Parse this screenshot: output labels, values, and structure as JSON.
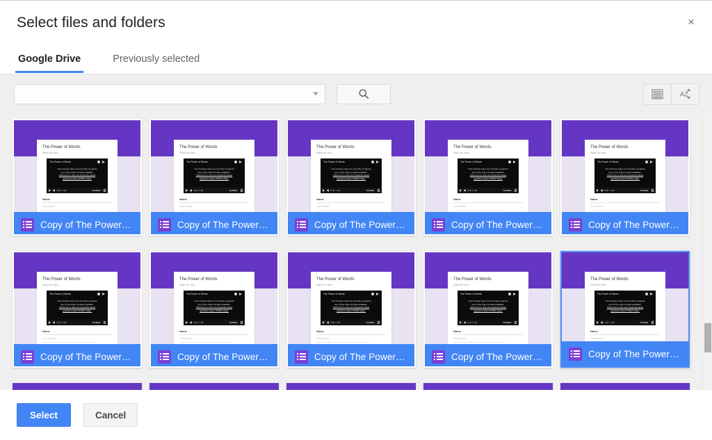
{
  "dialog": {
    "title": "Select files and folders",
    "close_label": "×"
  },
  "tabs": [
    {
      "label": "Google Drive",
      "active": true
    },
    {
      "label": "Previously selected",
      "active": false
    }
  ],
  "toolbar": {
    "search_select_value": "",
    "search_select_placeholder": "",
    "search_button_icon": "search-icon",
    "view_toggle_icon": "list-view-icon",
    "sort_toggle_icon": "sort-az-icon"
  },
  "grid": {
    "columns": 5,
    "cards": [
      {
        "name": "Copy of The Power of...",
        "selected": false
      },
      {
        "name": "Copy of The Power of...",
        "selected": false
      },
      {
        "name": "Copy of The Power of...",
        "selected": false
      },
      {
        "name": "Copy of The Power of...",
        "selected": false
      },
      {
        "name": "Copy of The Power of...",
        "selected": false
      },
      {
        "name": "Copy of The Power of...",
        "selected": false
      },
      {
        "name": "Copy of The Power of...",
        "selected": false
      },
      {
        "name": "Copy of The Power of...",
        "selected": false
      },
      {
        "name": "Copy of The Power of...",
        "selected": false
      },
      {
        "name": "Copy of The Power of...",
        "selected": true
      }
    ],
    "partial_row_count": 5
  },
  "thumbnail": {
    "form_title": "The Power of Words",
    "form_subtitle": "Watch the video",
    "video_title": "The Power of Words",
    "video_message_line1": "Your browser does not currently recognize",
    "video_message_line2": "any of the video formats available.",
    "video_message_link1": "Click here to visit our frequently asked",
    "video_message_link2": "questions about HTML5 video.",
    "video_time": "0:00 / 1:48",
    "video_logo": "YouTube",
    "question_label": "Name",
    "answer_placeholder": "Your answer"
  },
  "footer": {
    "select_label": "Select",
    "cancel_label": "Cancel"
  },
  "colors": {
    "accent_blue": "#4285f4",
    "forms_purple": "#6536c4",
    "thumb_background": "#e8e2f3",
    "toolbar_background": "#efefef"
  }
}
